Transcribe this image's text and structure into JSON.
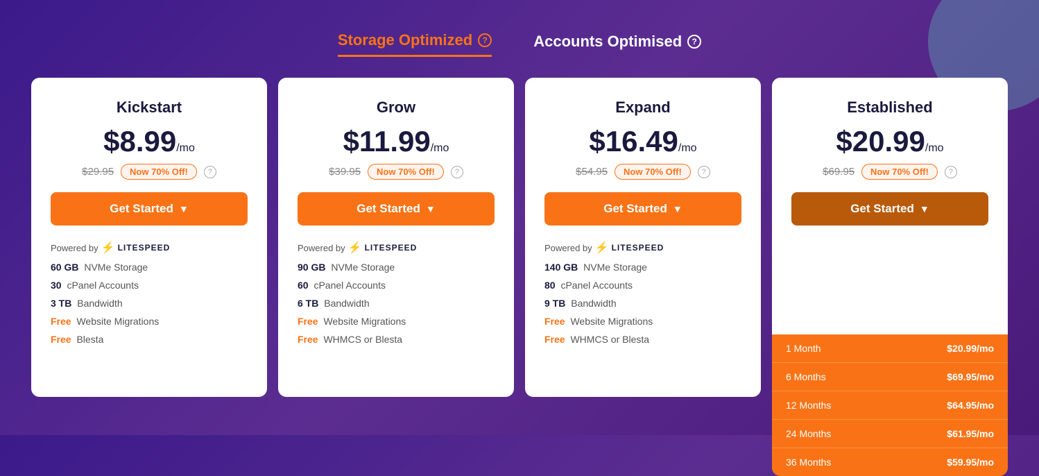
{
  "background": {
    "decoration": true
  },
  "tabs": [
    {
      "id": "storage-optimized",
      "label": "Storage Optimized",
      "active": true,
      "help": "?"
    },
    {
      "id": "accounts-optimised",
      "label": "Accounts Optimised",
      "active": false,
      "help": "?"
    }
  ],
  "plans": [
    {
      "id": "kickstart",
      "title": "Kickstart",
      "price": "$8.99",
      "per": "/mo",
      "original": "$29.95",
      "badge": "Now 70% Off!",
      "cta": "Get Started",
      "features": [
        {
          "bold": "",
          "colored": "Powered by",
          "rest": "",
          "litespeed": true
        },
        {
          "bold": "60 GB",
          "colored": "",
          "rest": " NVMe Storage"
        },
        {
          "bold": "30",
          "colored": "",
          "rest": " cPanel Accounts"
        },
        {
          "bold": "3 TB",
          "colored": "",
          "rest": " Bandwidth"
        },
        {
          "bold": "Free",
          "colored": "",
          "rest": " Website Migrations"
        },
        {
          "bold": "Free",
          "colored": "",
          "rest": " Blesta"
        }
      ]
    },
    {
      "id": "grow",
      "title": "Grow",
      "price": "$11.99",
      "per": "/mo",
      "original": "$39.95",
      "badge": "Now 70% Off!",
      "cta": "Get Started",
      "features": [
        {
          "bold": "",
          "colored": "Powered by",
          "rest": "",
          "litespeed": true
        },
        {
          "bold": "90 GB",
          "colored": "",
          "rest": " NVMe Storage"
        },
        {
          "bold": "60",
          "colored": "",
          "rest": " cPanel Accounts"
        },
        {
          "bold": "6 TB",
          "colored": "",
          "rest": " Bandwidth"
        },
        {
          "bold": "Free",
          "colored": "",
          "rest": " Website Migrations"
        },
        {
          "bold": "Free",
          "colored": "",
          "rest": " WHMCS or Blesta"
        }
      ]
    },
    {
      "id": "expand",
      "title": "Expand",
      "price": "$16.49",
      "per": "/mo",
      "original": "$54.95",
      "badge": "Now 70% Off!",
      "cta": "Get Started",
      "features": [
        {
          "bold": "",
          "colored": "Powered by",
          "rest": "",
          "litespeed": true
        },
        {
          "bold": "140 GB",
          "colored": "",
          "rest": " NVMe Storage"
        },
        {
          "bold": "80",
          "colored": "",
          "rest": " cPanel Accounts"
        },
        {
          "bold": "9 TB",
          "colored": "",
          "rest": " Bandwidth"
        },
        {
          "bold": "Free",
          "colored": "",
          "rest": " Website Migrations"
        },
        {
          "bold": "Free",
          "colored": "",
          "rest": " WHMCS or Blesta"
        }
      ]
    },
    {
      "id": "established",
      "title": "Established",
      "price": "$20.99",
      "per": "/mo",
      "original": "$69.95",
      "badge": "Now 70% Off!",
      "cta": "Get Started",
      "dark": true,
      "dropdown": true,
      "dropdown_items": [
        {
          "label": "1 Month",
          "price": "$20.99/mo"
        },
        {
          "label": "6 Months",
          "price": "$69.95/mo"
        },
        {
          "label": "12 Months",
          "price": "$64.95/mo"
        },
        {
          "label": "24 Months",
          "price": "$61.95/mo"
        },
        {
          "label": "36 Months",
          "price": "$59.95/mo"
        }
      ]
    }
  ],
  "litespeed": {
    "text": "LITESPEED"
  }
}
